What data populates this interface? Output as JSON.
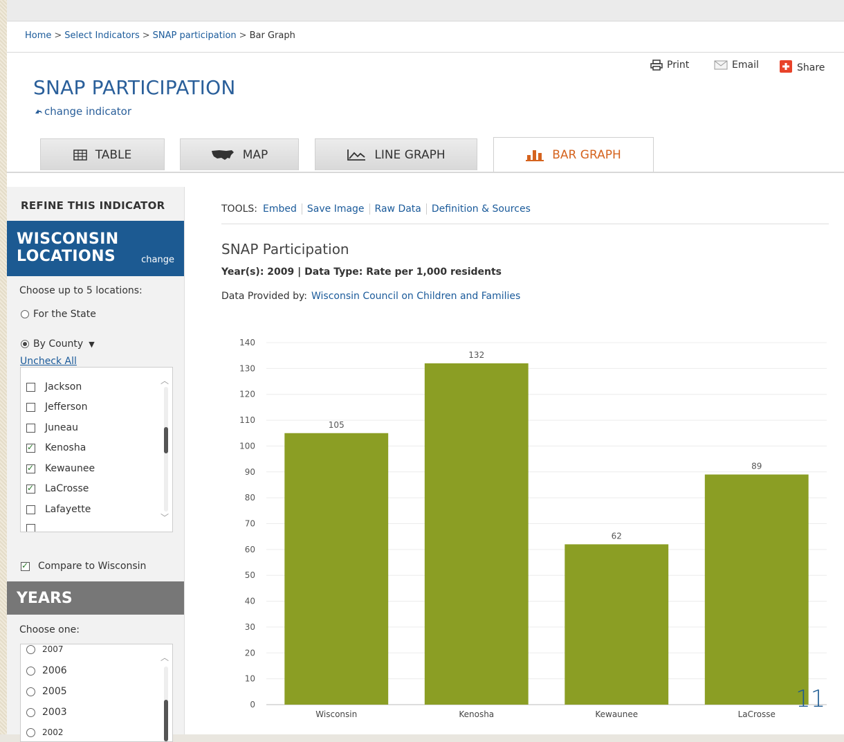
{
  "breadcrumb": {
    "items": [
      "Home",
      "Select Indicators",
      "SNAP participation"
    ],
    "current": "Bar Graph"
  },
  "header": {
    "title": "SNAP PARTICIPATION",
    "change_indicator": "change indicator",
    "print": "Print",
    "email": "Email",
    "share": "Share"
  },
  "tabs": [
    {
      "label": "TABLE",
      "icon": "table-icon"
    },
    {
      "label": "MAP",
      "icon": "us-map-icon"
    },
    {
      "label": "LINE GRAPH",
      "icon": "line-graph-icon"
    },
    {
      "label": "BAR GRAPH",
      "icon": "bar-graph-icon",
      "active": true
    }
  ],
  "sidebar": {
    "refine_title": "REFINE THIS INDICATOR",
    "locations_title_1": "WISCONSIN",
    "locations_title_2": "LOCATIONS",
    "locations_change": "change",
    "choose_locations": "Choose up to 5 locations:",
    "for_state": "For the State",
    "by_county": "By County",
    "uncheck_all": "Uncheck All",
    "counties": [
      {
        "name": "Jackson",
        "checked": false
      },
      {
        "name": "Jefferson",
        "checked": false
      },
      {
        "name": "Juneau",
        "checked": false
      },
      {
        "name": "Kenosha",
        "checked": true
      },
      {
        "name": "Kewaunee",
        "checked": true
      },
      {
        "name": "LaCrosse",
        "checked": true
      },
      {
        "name": "Lafayette",
        "checked": false
      }
    ],
    "compare_label": "Compare to Wisconsin",
    "years_title": "YEARS",
    "choose_year": "Choose one:",
    "years": [
      "2007",
      "2006",
      "2005",
      "2003",
      "2002"
    ]
  },
  "tools": {
    "label": "TOOLS:",
    "links": [
      "Embed",
      "Save Image",
      "Raw Data",
      "Definition & Sources"
    ]
  },
  "chart_info": {
    "title": "SNAP Participation",
    "subtitle": "Year(s): 2009 | Data Type: Rate per 1,000 residents",
    "provided_label": "Data Provided by:",
    "provider": "Wisconsin Council on Children and Families"
  },
  "chart_data": {
    "type": "bar",
    "categories": [
      "Wisconsin",
      "Kenosha",
      "Kewaunee",
      "LaCrosse"
    ],
    "values": [
      105,
      132,
      62,
      89
    ],
    "ylim": [
      0,
      140
    ],
    "yticks": [
      0,
      10,
      20,
      30,
      40,
      50,
      60,
      70,
      80,
      90,
      100,
      110,
      120,
      130,
      140
    ],
    "bar_color": "#8b9e24",
    "grid": true
  },
  "page_number": "11",
  "colors": {
    "accent_blue": "#1c5a92",
    "active_tab": "#d5631e",
    "link": "#1a5a9a"
  }
}
